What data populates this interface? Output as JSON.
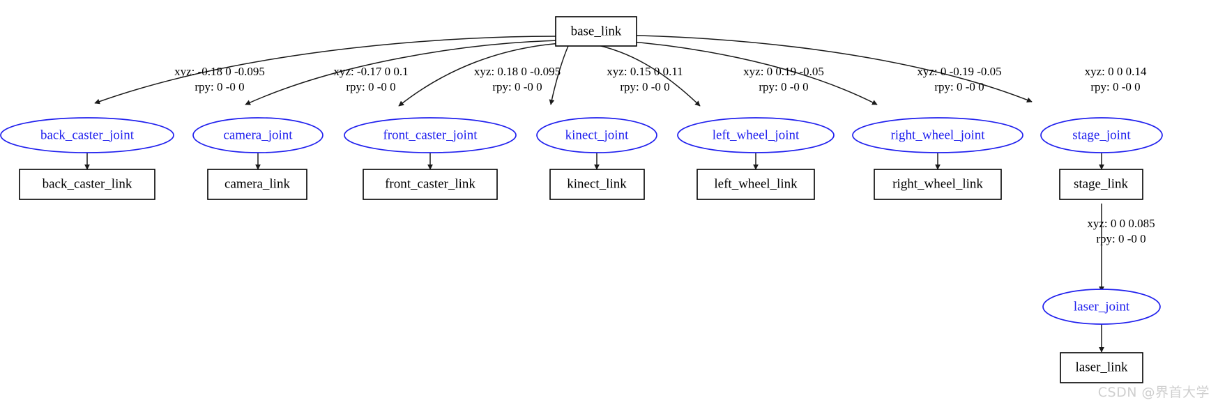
{
  "diagram": {
    "type": "urdf-tree",
    "root": {
      "id": "base_link",
      "label": "base_link",
      "shape": "box"
    },
    "link_nodes": [
      {
        "id": "base_link",
        "label": "base_link"
      },
      {
        "id": "back_caster_link",
        "label": "back_caster_link"
      },
      {
        "id": "camera_link",
        "label": "camera_link"
      },
      {
        "id": "front_caster_link",
        "label": "front_caster_link"
      },
      {
        "id": "kinect_link",
        "label": "kinect_link"
      },
      {
        "id": "left_wheel_link",
        "label": "left_wheel_link"
      },
      {
        "id": "right_wheel_link",
        "label": "right_wheel_link"
      },
      {
        "id": "stage_link",
        "label": "stage_link"
      },
      {
        "id": "laser_link",
        "label": "laser_link"
      }
    ],
    "joint_nodes": [
      {
        "id": "back_caster_joint",
        "label": "back_caster_joint"
      },
      {
        "id": "camera_joint",
        "label": "camera_joint"
      },
      {
        "id": "front_caster_joint",
        "label": "front_caster_joint"
      },
      {
        "id": "kinect_joint",
        "label": "kinect_joint"
      },
      {
        "id": "left_wheel_joint",
        "label": "left_wheel_joint"
      },
      {
        "id": "right_wheel_joint",
        "label": "right_wheel_joint"
      },
      {
        "id": "stage_joint",
        "label": "stage_joint"
      },
      {
        "id": "laser_joint",
        "label": "laser_joint"
      }
    ],
    "edges": [
      {
        "from": "base_link",
        "to": "back_caster_joint",
        "xyz": "xyz: -0.18 0 -0.095",
        "rpy": "rpy: 0 -0 0"
      },
      {
        "from": "base_link",
        "to": "camera_joint",
        "xyz": "xyz: -0.17 0 0.1",
        "rpy": "rpy: 0 -0 0"
      },
      {
        "from": "base_link",
        "to": "front_caster_joint",
        "xyz": "xyz: 0.18 0 -0.095",
        "rpy": "rpy: 0 -0 0"
      },
      {
        "from": "base_link",
        "to": "kinect_joint",
        "xyz": "xyz: 0.15 0 0.11",
        "rpy": "rpy: 0 -0 0"
      },
      {
        "from": "base_link",
        "to": "left_wheel_joint",
        "xyz": "xyz: 0 0.19 -0.05",
        "rpy": "rpy: 0 -0 0"
      },
      {
        "from": "base_link",
        "to": "right_wheel_joint",
        "xyz": "xyz: 0 -0.19 -0.05",
        "rpy": "rpy: 0 -0 0"
      },
      {
        "from": "base_link",
        "to": "stage_joint",
        "xyz": "xyz: 0 0 0.14",
        "rpy": "rpy: 0 -0 0"
      },
      {
        "from": "stage_link",
        "to": "laser_joint",
        "xyz": "xyz: 0 0 0.085",
        "rpy": "rpy: 0 -0 0"
      }
    ],
    "colors": {
      "joint_stroke": "#2020ee",
      "joint_text": "#2020ee",
      "link_stroke": "#000000",
      "link_text": "#000000",
      "edge_stroke": "#1a1a1a",
      "background": "#ffffff",
      "watermark": "#cfcfcf"
    }
  },
  "watermark": {
    "text": "CSDN @界首大学"
  },
  "labels": {
    "base_link": "base_link",
    "back_caster_joint": "back_caster_joint",
    "camera_joint": "camera_joint",
    "front_caster_joint": "front_caster_joint",
    "kinect_joint": "kinect_joint",
    "left_wheel_joint": "left_wheel_joint",
    "right_wheel_joint": "right_wheel_joint",
    "stage_joint": "stage_joint",
    "laser_joint": "laser_joint",
    "back_caster_link": "back_caster_link",
    "camera_link": "camera_link",
    "front_caster_link": "front_caster_link",
    "kinect_link": "kinect_link",
    "left_wheel_link": "left_wheel_link",
    "right_wheel_link": "right_wheel_link",
    "stage_link": "stage_link",
    "laser_link": "laser_link",
    "e0_xyz": "xyz: -0.18 0 -0.095",
    "e0_rpy": "rpy: 0 -0 0",
    "e1_xyz": "xyz: -0.17 0 0.1",
    "e1_rpy": "rpy: 0 -0 0",
    "e2_xyz": "xyz: 0.18 0 -0.095",
    "e2_rpy": "rpy: 0 -0 0",
    "e3_xyz": "xyz: 0.15 0 0.11",
    "e3_rpy": "rpy: 0 -0 0",
    "e4_xyz": "xyz: 0 0.19 -0.05",
    "e4_rpy": "rpy: 0 -0 0",
    "e5_xyz": "xyz: 0 -0.19 -0.05",
    "e5_rpy": "rpy: 0 -0 0",
    "e6_xyz": "xyz: 0 0 0.14",
    "e6_rpy": "rpy: 0 -0 0",
    "e7_xyz": "xyz: 0 0 0.085",
    "e7_rpy": "rpy: 0 -0 0"
  }
}
